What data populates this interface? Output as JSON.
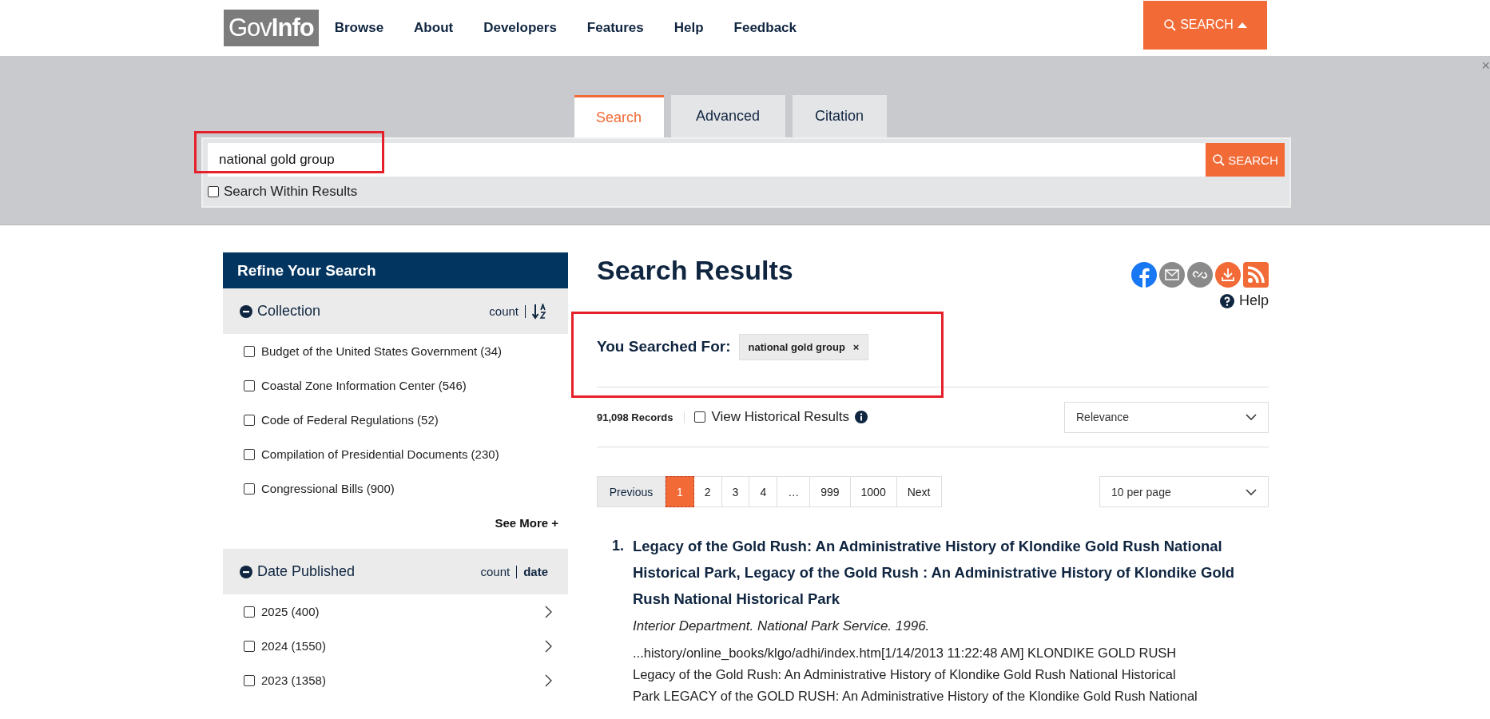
{
  "header": {
    "logo": {
      "part_1": "Gov",
      "part_2": "Info"
    },
    "nav": [
      "Browse",
      "About",
      "Developers",
      "Features",
      "Help",
      "Feedback"
    ],
    "search_toggle": {
      "label": "SEARCH",
      "expanded": true
    },
    "close": "×"
  },
  "search_panel": {
    "tabs": [
      {
        "label": "Search",
        "selected": true
      },
      {
        "label": "Advanced",
        "selected": false
      },
      {
        "label": "Citation",
        "selected": false
      }
    ],
    "query": "national gold group",
    "highlighted": true,
    "submit": "SEARCH",
    "within": {
      "label": "Search Within Results",
      "checked": false
    }
  },
  "sidebar": {
    "title": "Refine Your Search",
    "facets": [
      {
        "name": "Collection",
        "kind": "collection",
        "expanded": true,
        "sort_count": "count",
        "items": [
          {
            "label": "Budget of the United States Government (34)",
            "checked": false
          },
          {
            "label": "Coastal Zone Information Center (546)",
            "checked": false
          },
          {
            "label": "Code of Federal Regulations (52)",
            "checked": false
          },
          {
            "label": "Compilation of Presidential Documents (230)",
            "checked": false
          },
          {
            "label": "Congressional Bills (900)",
            "checked": false
          }
        ],
        "see_more": "See More +"
      },
      {
        "name": "Date Published",
        "kind": "date",
        "expanded": true,
        "sort_count": "count",
        "sort_alt": "date",
        "items": [
          {
            "label": "2025 (400)",
            "checked": false
          },
          {
            "label": "2024 (1550)",
            "checked": false
          },
          {
            "label": "2023 (1358)",
            "checked": false
          }
        ]
      }
    ]
  },
  "results": {
    "title": "Search Results",
    "help": "Help",
    "you_searched_for": {
      "label": "You Searched For:",
      "term": "national gold group",
      "remove": "×",
      "highlighted": true
    },
    "records": "91,098 Records",
    "historical": {
      "label": "View Historical Results",
      "checked": false
    },
    "sort": "Relevance",
    "pagination": [
      {
        "label": "Previous",
        "selected": false
      },
      {
        "label": "1",
        "selected": true
      },
      {
        "label": "2",
        "selected": false
      },
      {
        "label": "3",
        "selected": false
      },
      {
        "label": "4",
        "selected": false
      },
      {
        "label": "…",
        "selected": false
      },
      {
        "label": "999",
        "selected": false
      },
      {
        "label": "1000",
        "selected": false
      },
      {
        "label": "Next",
        "selected": false
      }
    ],
    "per_page": "10 per page",
    "items": [
      {
        "number": "1.",
        "title": "Legacy of the Gold Rush: An Administrative History of Klondike Gold Rush National Historical Park, Legacy of the Gold Rush : An Administrative History of Klondike Gold Rush National Historical Park",
        "source": "Interior Department. National Park Service. 1996.",
        "snippet": "...history/online_books/klgo/adhi/index.htm[1/14/2013 11:22:48 AM] KLONDIKE GOLD RUSH Legacy of the Gold Rush: An Administrative History of Klondike Gold Rush National Historical Park LEGACY of the GOLD RUSH: An Administrative History of the Klondike Gold Rush National"
      }
    ]
  }
}
